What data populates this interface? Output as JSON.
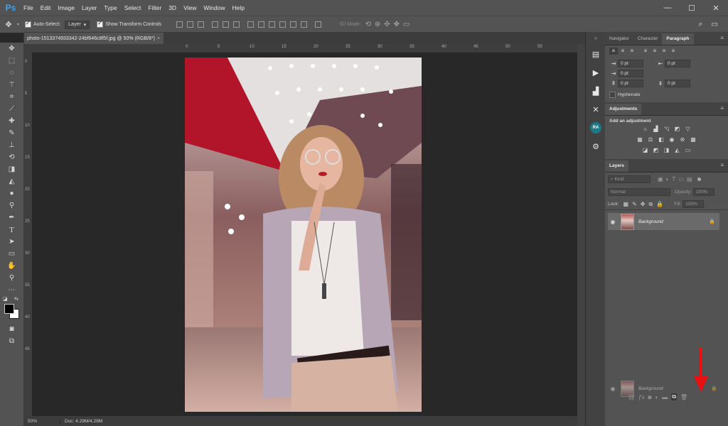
{
  "app": {
    "logo": "Ps"
  },
  "menu": [
    "File",
    "Edit",
    "Image",
    "Layer",
    "Type",
    "Select",
    "Filter",
    "3D",
    "View",
    "Window",
    "Help"
  ],
  "window_controls": {
    "minimize": "—",
    "maximize": "☐",
    "close": "✕"
  },
  "options_bar": {
    "auto_select_label": "Auto-Select:",
    "auto_select_value": "Layer",
    "show_transform_label": "Show Transform Controls",
    "mode_3d_label": "3D Mode:"
  },
  "document": {
    "tab_title": "photo-1513374933342-24bf646c8f5f.jpg @ 50% (RGB/8*)",
    "tab_close": "×",
    "zoom": "50%",
    "doc_size": "Doc: 4.29M/4.29M"
  },
  "rulers": {
    "h": [
      "0",
      "5",
      "10",
      "15",
      "20",
      "25",
      "30",
      "35",
      "40",
      "45",
      "50",
      "55"
    ],
    "v": [
      "0",
      "5",
      "10",
      "15",
      "20",
      "25",
      "30",
      "35",
      "40",
      "45"
    ]
  },
  "panels": {
    "top_tabs": [
      "Navigator",
      "Character",
      "Paragraph"
    ],
    "top_active": "Paragraph",
    "paragraph": {
      "indent_left": "0 pt",
      "indent_right": "0 pt",
      "first_line": "0 pt",
      "space_before": "0 pt",
      "space_after": "0 pt",
      "hyphenate_label": "Hyphenate"
    },
    "adjustments": {
      "tab": "Adjustments",
      "hint": "Add an adjustment"
    },
    "layers": {
      "tab": "Layers",
      "kind_label": "Kind",
      "blend_mode": "Normal",
      "opacity_label": "Opacity:",
      "opacity_value": "100%",
      "lock_label": "Lock:",
      "fill_label": "Fill:",
      "fill_value": "100%",
      "layer_name": "Background",
      "ghost_layer_name": "Background"
    }
  },
  "icon_strip": {
    "ra_label": "RA"
  },
  "colors": {
    "accent": "#31a8ff",
    "arrow": "#e81010",
    "panel": "#535353",
    "canvas": "#282828"
  }
}
